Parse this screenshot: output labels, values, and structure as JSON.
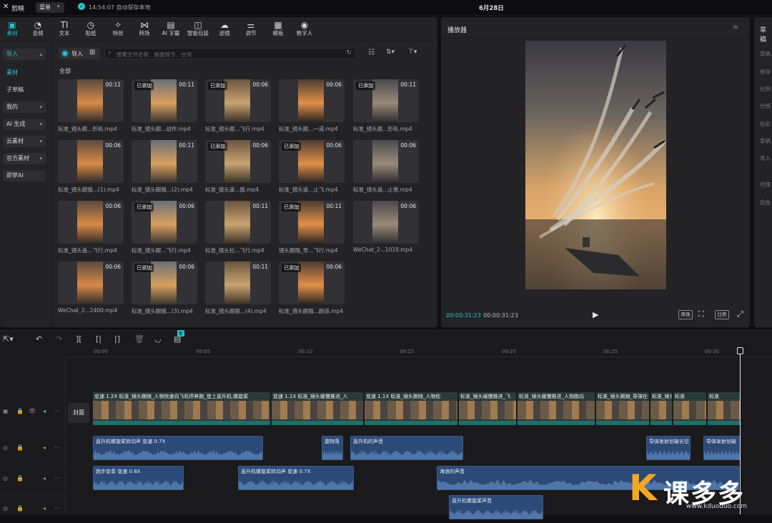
{
  "titlebar": {
    "app_name": "剪映",
    "menu_label": "菜单",
    "save_status": "14:54:07 自动保存本地",
    "project_title": "6月28日"
  },
  "toolbar": {
    "items": [
      {
        "label": "素材",
        "icon": "media-icon"
      },
      {
        "label": "音频",
        "icon": "audio-icon"
      },
      {
        "label": "文本",
        "icon": "text-icon"
      },
      {
        "label": "贴纸",
        "icon": "sticker-icon"
      },
      {
        "label": "特效",
        "icon": "effects-icon"
      },
      {
        "label": "转场",
        "icon": "transition-icon"
      },
      {
        "label": "AI 字幕",
        "icon": "ai-caption-icon"
      },
      {
        "label": "智能包装",
        "icon": "smart-pack-icon"
      },
      {
        "label": "滤镜",
        "icon": "filter-icon"
      },
      {
        "label": "调节",
        "icon": "adjust-icon"
      },
      {
        "label": "模板",
        "icon": "template-icon"
      },
      {
        "label": "数字人",
        "icon": "digital-human-icon"
      }
    ]
  },
  "sidebar": {
    "items": [
      "导入",
      "素材",
      "子草稿",
      "我的",
      "AI 生成",
      "云素材",
      "官方素材",
      "即梦AI"
    ]
  },
  "media": {
    "import_label": "导入",
    "search_placeholder": "搜索文件名称、画面情节、台词",
    "section_label": "全部",
    "items": [
      {
        "name": "标准_镜头跟...形轨.mp4",
        "duration": "00:11",
        "tag": ""
      },
      {
        "name": "标准_镜头跟...动作.mp4",
        "duration": "00:11",
        "tag": "已添加"
      },
      {
        "name": "标准_镜头跟...飞行.mp4",
        "duration": "00:06",
        "tag": "已添加"
      },
      {
        "name": "标准_镜头跟...一道.mp4",
        "duration": "00:06",
        "tag": ""
      },
      {
        "name": "标准_镜头跟...形轨.mp4",
        "duration": "00:11",
        "tag": "已添加"
      },
      {
        "name": "标准_镜头跟随...(1).mp4",
        "duration": "00:06",
        "tag": ""
      },
      {
        "name": "标准_镜头跟随...(2).mp4",
        "duration": "00:11",
        "tag": ""
      },
      {
        "name": "标准_镜头遥...面.mp4",
        "duration": "00:06",
        "tag": "已添加"
      },
      {
        "name": "标准_镜头遥...止飞.mp4",
        "duration": "00:06",
        "tag": "已添加"
      },
      {
        "name": "标准_镜头遥...止推.mp4",
        "duration": "00:06",
        "tag": ""
      },
      {
        "name": "标准_镜头遥...飞行.mp4",
        "duration": "00:06",
        "tag": ""
      },
      {
        "name": "标准_镜头跟...飞行.mp4",
        "duration": "00:06",
        "tag": "已添加"
      },
      {
        "name": "标准_镜头拉...飞行.mp4",
        "duration": "00:11",
        "tag": ""
      },
      {
        "name": "镜头跟随_导...飞行.mp4",
        "duration": "00:11",
        "tag": "已添加"
      },
      {
        "name": "WeChat_2...1019.mp4",
        "duration": "00:06",
        "tag": ""
      },
      {
        "name": "WeChat_2...2400.mp4",
        "duration": "00:06",
        "tag": ""
      },
      {
        "name": "标准_镜头跟随...(3).mp4",
        "duration": "00:06",
        "tag": "已添加"
      },
      {
        "name": "标准_镜头跟随...(4).mp4",
        "duration": "00:11",
        "tag": ""
      },
      {
        "name": "标准_镜头跟随...跑道.mp4",
        "duration": "00:06",
        "tag": "已添加"
      }
    ]
  },
  "player": {
    "title": "播放器",
    "current_time": "00:00:31:23",
    "total_time": "00:00:31:23",
    "btn_original": "原画",
    "btn_ratio": "比例"
  },
  "right_panel": {
    "title": "草稿",
    "items": [
      "草稿",
      "保存",
      "比例",
      "分辨",
      "色彩",
      "草稿",
      "导入",
      "代理",
      "自由"
    ]
  },
  "timeline": {
    "badge": "新",
    "ruler": [
      "00:00",
      "00:05",
      "00:10",
      "00:15",
      "00:20",
      "00:25",
      "00:30"
    ],
    "cover_label": "封面",
    "video_segments": [
      {
        "speed": "变速 1.2X",
        "name": "标准_镜头跟随_人物快速向飞机停奔跑_登上直升机,螺旋桨"
      },
      {
        "speed": "变速 1.1X",
        "name": "标准_镜头缓慢推进_人"
      },
      {
        "speed": "变速 1.1X",
        "name": "标准_镜头跟随_人物松"
      },
      {
        "speed": "",
        "name": "标准_镜头缓慢推进_飞"
      },
      {
        "speed": "",
        "name": "标准_镜头缓慢推进_人物跑向"
      },
      {
        "speed": "",
        "name": "标准_镜头跟随_导弹在"
      },
      {
        "speed": "",
        "name": "标准_镜头"
      },
      {
        "speed": "",
        "name": "标准"
      },
      {
        "speed": "",
        "name": "标准"
      }
    ],
    "audio_track1": [
      {
        "label": "直升机螺旋桨转动声",
        "speed": "变速 0.7X"
      },
      {
        "label": "震物落",
        "speed": ""
      },
      {
        "label": "直升机的声音",
        "speed": ""
      },
      {
        "label": "导弹发射划破长空",
        "speed": ""
      },
      {
        "label": "导弹发射划破",
        "speed": ""
      }
    ],
    "audio_track2": [
      {
        "label": "跑步变奏",
        "speed": "变速 0.8X"
      },
      {
        "label": "直升机螺旋桨转动声",
        "speed": "变速 0.7X"
      },
      {
        "label": "海浪的声音",
        "speed": ""
      }
    ],
    "audio_track3": [
      {
        "label": "直升机螺旋桨声音",
        "speed": ""
      }
    ]
  },
  "watermark": {
    "text": "课多多",
    "url": "www.kduoduo.com"
  }
}
